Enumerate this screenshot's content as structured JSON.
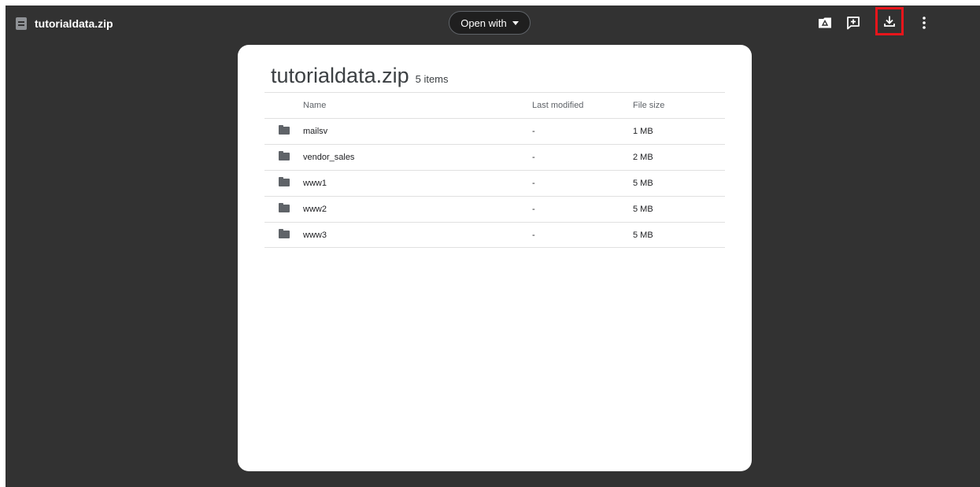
{
  "topbar": {
    "file_name": "tutorialdata.zip",
    "file_icon": "document-icon",
    "open_with_label": "Open with",
    "actions": [
      {
        "name": "add-to-drive-icon"
      },
      {
        "name": "add-comment-icon"
      },
      {
        "name": "download-icon",
        "highlight_color": "#e8151b"
      },
      {
        "name": "more-vert-icon"
      }
    ]
  },
  "archive": {
    "title": "tutorialdata.zip",
    "item_count": "5 items",
    "columns": {
      "name": "Name",
      "last_modified": "Last modified",
      "file_size": "File size"
    },
    "rows": [
      {
        "name": "mailsv",
        "modified": "-",
        "size": "1 MB"
      },
      {
        "name": "vendor_sales",
        "modified": "-",
        "size": "2 MB"
      },
      {
        "name": "www1",
        "modified": "-",
        "size": "5 MB"
      },
      {
        "name": "www2",
        "modified": "-",
        "size": "5 MB"
      },
      {
        "name": "www3",
        "modified": "-",
        "size": "5 MB"
      }
    ]
  },
  "colors": {
    "viewer_background": "#323232",
    "card_background": "#ffffff",
    "highlight": "#e8151b"
  }
}
